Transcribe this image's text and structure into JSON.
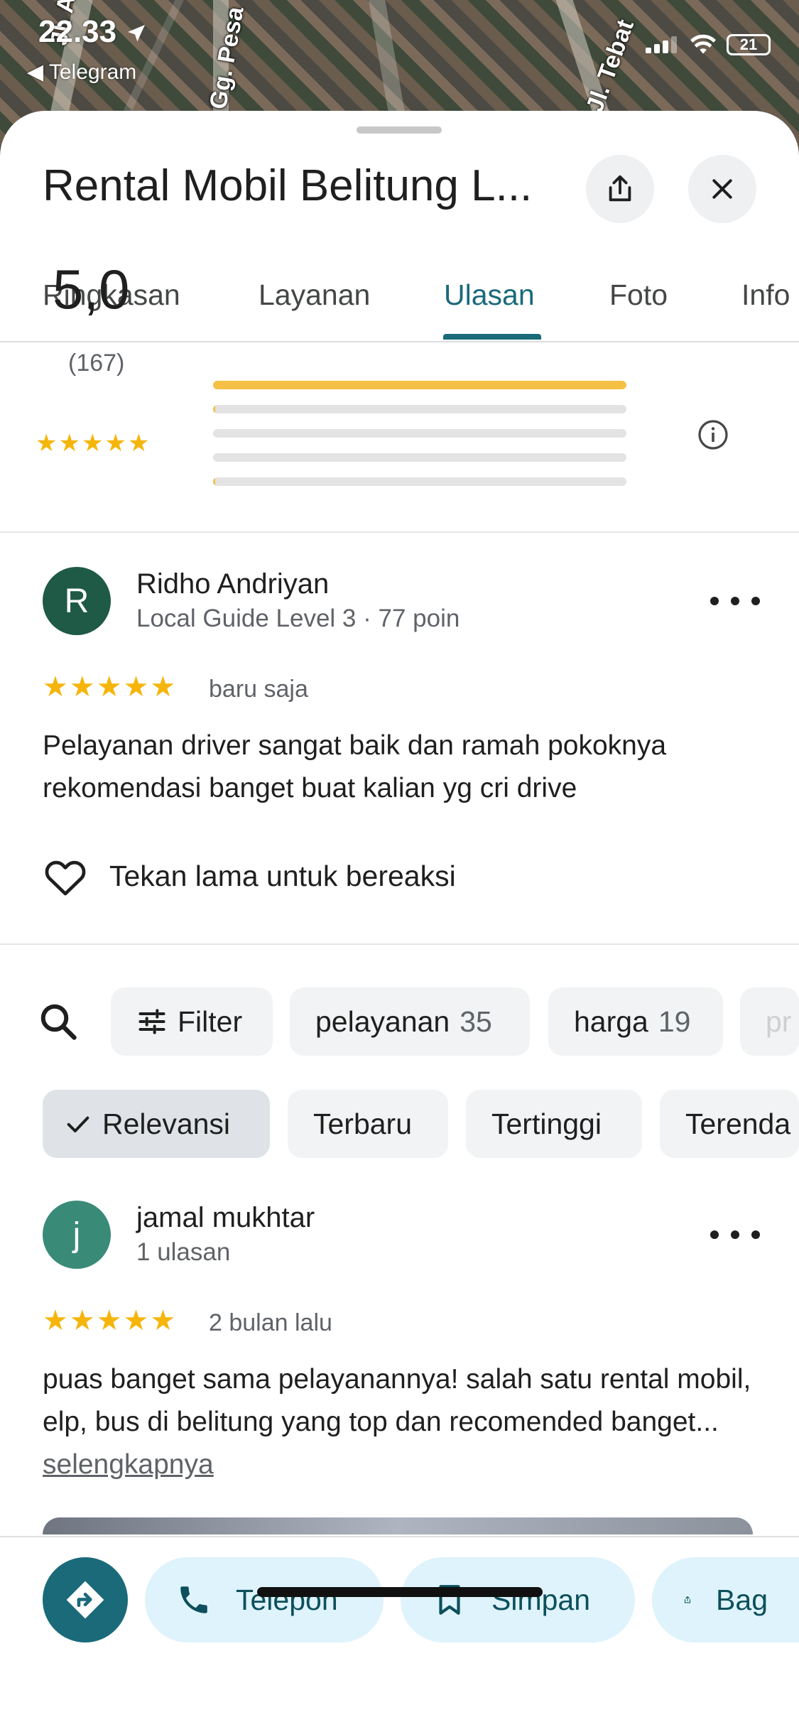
{
  "status_bar": {
    "time": "22.33",
    "back_app": "Telegram",
    "battery": "21"
  },
  "map_labels": [
    "Jl. Ar Ag",
    "Gg. Pesa",
    "Jl. Tebat"
  ],
  "place": {
    "title": "Rental Mobil Belitung L..."
  },
  "tabs": [
    {
      "label": "Ringkasan",
      "active": false
    },
    {
      "label": "Layanan",
      "active": false
    },
    {
      "label": "Ulasan",
      "active": true
    },
    {
      "label": "Foto",
      "active": false
    },
    {
      "label": "Info",
      "active": false
    }
  ],
  "rating_summary": {
    "score": "5,0",
    "stars": 5,
    "count": "(167)",
    "distribution": [
      {
        "stars": 5,
        "fraction": 1.0
      },
      {
        "stars": 4,
        "fraction": 0.005
      },
      {
        "stars": 3,
        "fraction": 0.0
      },
      {
        "stars": 2,
        "fraction": 0.0
      },
      {
        "stars": 1,
        "fraction": 0.005
      }
    ]
  },
  "own_review": {
    "avatar_letter": "R",
    "avatar_color": "#1e5a46",
    "name": "Ridho Andriyan",
    "subtitle": "Local Guide Level 3 · 77 poin",
    "stars": 5,
    "time": "baru saja",
    "text": "Pelayanan driver sangat baik dan ramah pokoknya rekomendasi banget buat kalian yg cri drive",
    "react_label": "Tekan lama untuk bereaksi"
  },
  "filter_chips": [
    {
      "label": "Filter",
      "count": ""
    },
    {
      "label": "pelayanan",
      "count": "35"
    },
    {
      "label": "harga",
      "count": "19"
    },
    {
      "label": "pr",
      "count": ""
    }
  ],
  "sort_chips": [
    {
      "label": "Relevansi",
      "selected": true
    },
    {
      "label": "Terbaru",
      "selected": false
    },
    {
      "label": "Tertinggi",
      "selected": false
    },
    {
      "label": "Terenda",
      "selected": false
    }
  ],
  "review": {
    "avatar_letter": "j",
    "avatar_color": "#3a8a78",
    "name": "jamal mukhtar",
    "subtitle": "1 ulasan",
    "stars": 5,
    "time": "2 bulan lalu",
    "text": "puas banget sama pelayanannya! salah satu rental mobil, elp, bus di belitung yang top dan recomended banget...",
    "more_label": "selengkapnya"
  },
  "bottom_actions": {
    "call": "Telepon",
    "save": "Simpan",
    "share": "Bag"
  },
  "colors": {
    "accent": "#1a6a7a",
    "star": "#f5b50a",
    "bar": "#f5c044",
    "pill": "#def3fb"
  }
}
